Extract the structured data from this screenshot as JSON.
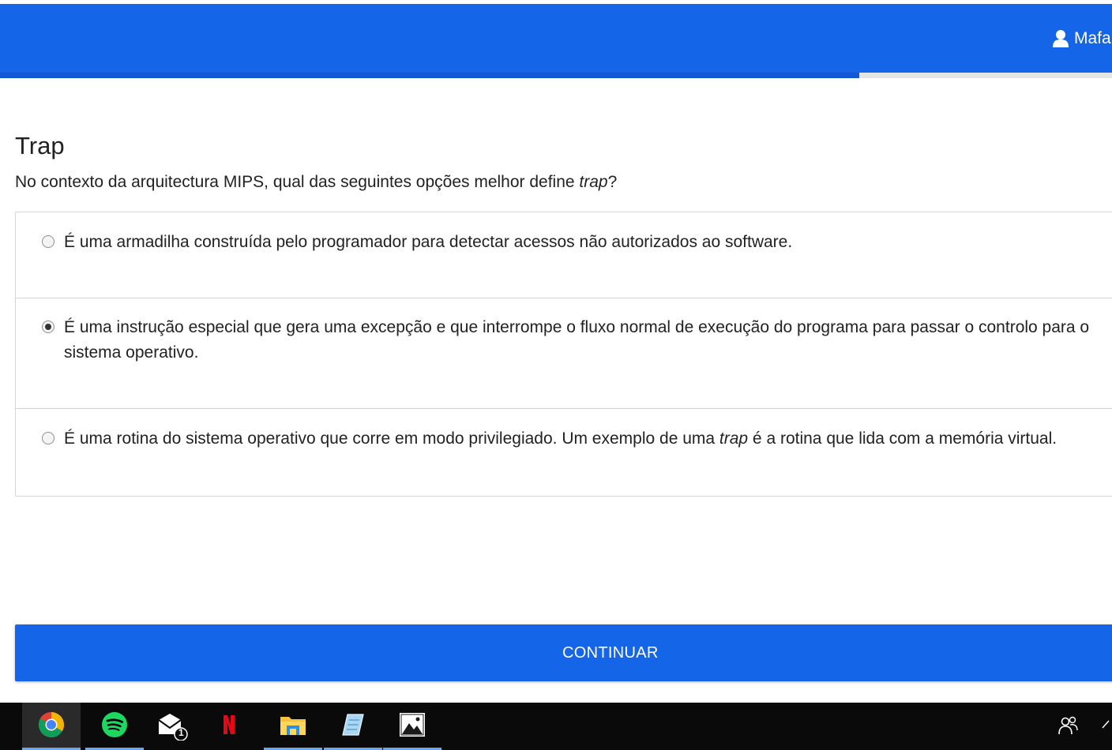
{
  "header": {
    "user_name": "Mafa",
    "user_icon": "user-icon",
    "progress_fraction": 0.773,
    "colors": {
      "primary": "#1565e8",
      "progress": "#1356d6"
    }
  },
  "question": {
    "title": "Trap",
    "text_before": "No contexto da arquitectura MIPS, qual das seguintes opções melhor define ",
    "text_emphasis": "trap",
    "text_after": "?"
  },
  "options": [
    {
      "checked": false,
      "text": "É uma armadilha construída pelo programador para detectar acessos não autorizados ao software."
    },
    {
      "checked": true,
      "text": "É uma instrução especial que gera uma excepção e que interrompe o fluxo normal de execução do programa para passar o controlo para o sistema operativo."
    },
    {
      "checked": false,
      "text_before": "É uma rotina do sistema operativo que corre em modo privilegiado. Um exemplo de uma ",
      "text_emphasis": "trap",
      "text_after": " é a rotina que lida com a memória virtual."
    }
  ],
  "actions": {
    "continue_label": "CONTINUAR"
  },
  "taskbar": {
    "apps": [
      {
        "icon": "chrome-icon",
        "active": true
      },
      {
        "icon": "spotify-icon",
        "active": false,
        "underlined": true
      },
      {
        "icon": "mail-icon",
        "active": false,
        "badge": "1"
      },
      {
        "icon": "netflix-icon",
        "active": false
      },
      {
        "icon": "file-explorer-icon",
        "active": false,
        "underlined": true
      },
      {
        "icon": "notepad-icon",
        "active": false,
        "underlined": true
      },
      {
        "icon": "photos-icon",
        "active": false,
        "underlined": true
      }
    ],
    "tray_icons": [
      "people-icon",
      "chevron-up-icon"
    ]
  }
}
